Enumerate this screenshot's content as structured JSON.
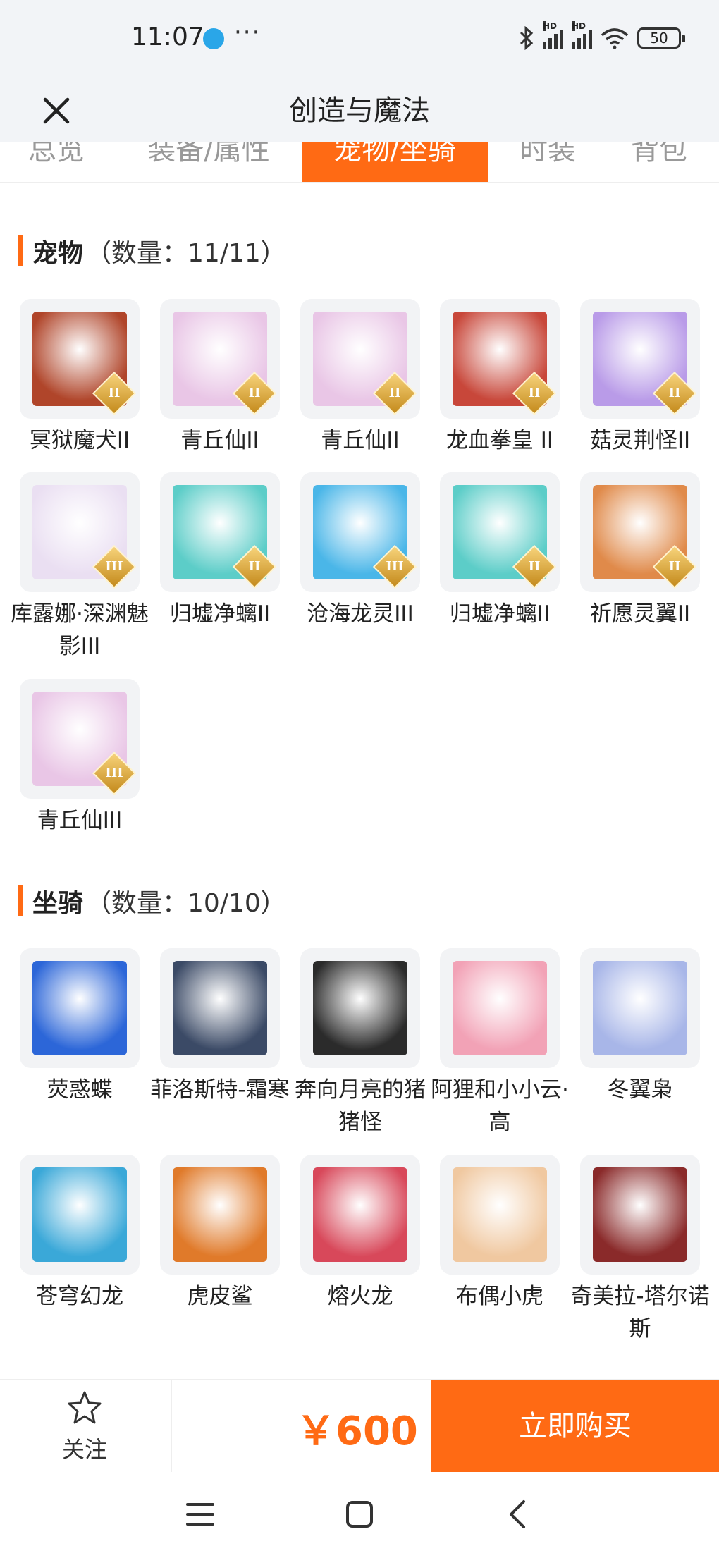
{
  "status_bar": {
    "time": "11:07",
    "more": "···",
    "battery": "50",
    "hd_label": "HD"
  },
  "header": {
    "title": "创造与魔法"
  },
  "tabs": [
    {
      "label": "总览",
      "active": false
    },
    {
      "label": "装备/属性",
      "active": false
    },
    {
      "label": "宠物/坐骑",
      "active": true
    },
    {
      "label": "时装",
      "active": false
    },
    {
      "label": "背包",
      "active": false
    }
  ],
  "pets": {
    "name": "宠物",
    "count": "（数量：11/11）",
    "items": [
      {
        "name": "冥狱魔犬II",
        "rank": "II",
        "color": "#b0452a"
      },
      {
        "name": "青丘仙II",
        "rank": "II",
        "color": "#e9c6e6"
      },
      {
        "name": "青丘仙II",
        "rank": "II",
        "color": "#e9c6e6"
      },
      {
        "name": "龙血拳皇 II",
        "rank": "II",
        "color": "#c8473a"
      },
      {
        "name": "菇灵荆怪II",
        "rank": "II",
        "color": "#b99be8"
      },
      {
        "name": "库露娜·深渊魅影III",
        "rank": "III",
        "color": "#eadff2"
      },
      {
        "name": "归墟净螭II",
        "rank": "II",
        "color": "#5ccdc8"
      },
      {
        "name": "沧海龙灵III",
        "rank": "III",
        "color": "#4ab6e8"
      },
      {
        "name": "归墟净螭II",
        "rank": "II",
        "color": "#5ccdc8"
      },
      {
        "name": "祈愿灵翼II",
        "rank": "II",
        "color": "#e08a4a"
      },
      {
        "name": "青丘仙III",
        "rank": "III",
        "color": "#e9c6e6"
      }
    ]
  },
  "mounts": {
    "name": "坐骑",
    "count": "（数量：10/10）",
    "items": [
      {
        "name": "荧惑蝶",
        "color": "#2c66d8"
      },
      {
        "name": "菲洛斯特-霜寒",
        "color": "#3b4a66"
      },
      {
        "name": "奔向月亮的猪猪怪",
        "color": "#2b2b2b"
      },
      {
        "name": "阿狸和小小云·高",
        "color": "#f2a2b6"
      },
      {
        "name": "冬翼枭",
        "color": "#a8b6e8"
      },
      {
        "name": "苍穹幻龙",
        "color": "#3aa8d8"
      },
      {
        "name": "虎皮鲨",
        "color": "#e07a2a"
      },
      {
        "name": "熔火龙",
        "color": "#d8485a"
      },
      {
        "name": "布偶小虎",
        "color": "#f0c8a0"
      },
      {
        "name": "奇美拉-塔尔诺斯",
        "color": "#8a2a2a"
      }
    ]
  },
  "action_bar": {
    "follow_label": "关注",
    "price": "￥600",
    "buy_label": "立即购买"
  },
  "colors": {
    "accent": "#ff6a14"
  }
}
